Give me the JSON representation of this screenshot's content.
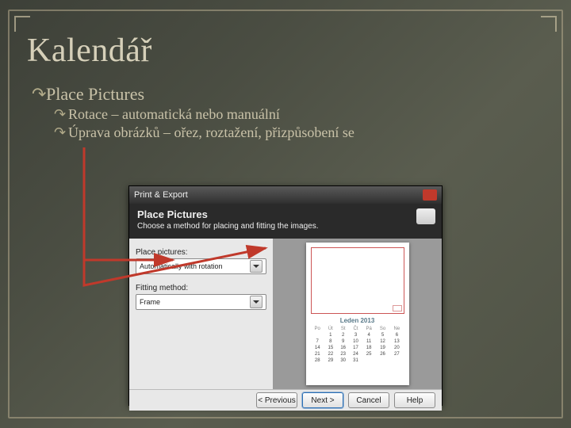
{
  "slide": {
    "title": "Kalendář",
    "bullets": {
      "b1": "Place Pictures",
      "b2a": "Rotace – automatická nebo manuální",
      "b2b": "Úprava obrázků – ořez, roztažení, přizpůsobení se"
    }
  },
  "dialog": {
    "window_title": "Print & Export",
    "header_title": "Place Pictures",
    "header_sub": "Choose a method for placing and fitting the images.",
    "left": {
      "label1": "Place pictures:",
      "combo1": "Automatically with rotation",
      "label2": "Fitting method:",
      "combo2": "Frame"
    },
    "calendar": {
      "title": "Leden 2013",
      "dow": [
        "Po",
        "Út",
        "St",
        "Čt",
        "Pá",
        "So",
        "Ne"
      ],
      "weeks": [
        [
          "",
          "1",
          "2",
          "3",
          "4",
          "5",
          "6"
        ],
        [
          "7",
          "8",
          "9",
          "10",
          "11",
          "12",
          "13"
        ],
        [
          "14",
          "15",
          "16",
          "17",
          "18",
          "19",
          "20"
        ],
        [
          "21",
          "22",
          "23",
          "24",
          "25",
          "26",
          "27"
        ],
        [
          "28",
          "29",
          "30",
          "31",
          "",
          "",
          ""
        ]
      ]
    },
    "buttons": {
      "prev": "< Previous",
      "next": "Next >",
      "cancel": "Cancel",
      "help": "Help"
    }
  }
}
